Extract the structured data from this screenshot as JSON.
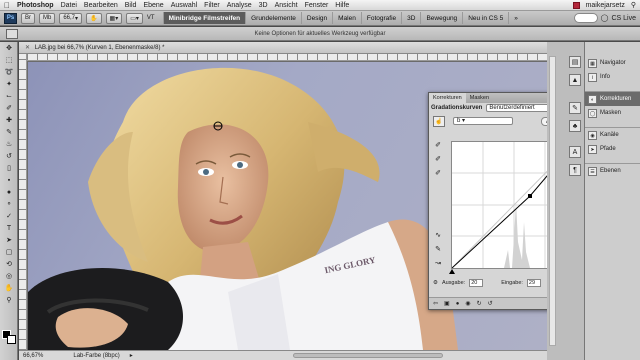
{
  "menubar": {
    "apple": "",
    "app": "Photoshop",
    "items": [
      "Datei",
      "Bearbeiten",
      "Bild",
      "Ebene",
      "Auswahl",
      "Filter",
      "Analyse",
      "3D",
      "Ansicht",
      "Fenster",
      "Hilfe"
    ],
    "user": "maikejarsetz"
  },
  "appbar": {
    "logo": "Ps",
    "zoom": "66,7",
    "vt": "VT",
    "workspaces": [
      "Minibridge Filmstreifen",
      "Grundelemente",
      "Design",
      "Malen",
      "Fotografie",
      "3D",
      "Bewegung",
      "Neu in CS 5"
    ],
    "more": "»",
    "cslive": "CS Live"
  },
  "optbar": {
    "message": "Keine Optionen für aktuelles Werkzeug verfügbar"
  },
  "document": {
    "tab_title": "LAB.jpg bei 66,7% (Kurven 1, Ebenenmaske/8) *",
    "zoom": "66,67%",
    "mode": "Lab-Farbe (8bpc)",
    "shirt_text": "ING GLORY"
  },
  "panel": {
    "tabs": [
      "Korrekturen",
      "Masken"
    ],
    "title": "Gradationskurven",
    "preset": "Benutzerdefiniert",
    "channel": "b",
    "auto": "Auto",
    "output_label": "Ausgabe:",
    "output_value": "20",
    "input_label": "Eingabe:",
    "input_value": "29"
  },
  "dock": {
    "items": [
      {
        "icon": "navigator-icon",
        "label": "Navigator"
      },
      {
        "icon": "info-icon",
        "label": "Info"
      },
      {
        "icon": "adjustments-icon",
        "label": "Korrekturen"
      },
      {
        "icon": "masks-icon",
        "label": "Masken"
      },
      {
        "icon": "channels-icon",
        "label": "Kanäle"
      },
      {
        "icon": "paths-icon",
        "label": "Pfade"
      },
      {
        "icon": "layers-icon",
        "label": "Ebenen"
      }
    ]
  },
  "colors": {
    "accent_selected": "#5c5c5c",
    "record": "#b2263a",
    "backdrop": "#a4a9c6"
  }
}
